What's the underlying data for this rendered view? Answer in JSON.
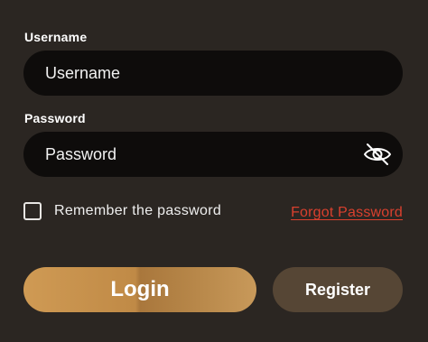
{
  "form": {
    "username": {
      "label": "Username",
      "placeholder": "Username",
      "value": ""
    },
    "password": {
      "label": "Password",
      "placeholder": "Password",
      "value": "",
      "toggle_icon": "eye-slash-icon"
    },
    "remember": {
      "label": "Remember the password",
      "checked": false
    },
    "forgot_label": "Forgot Password",
    "login_label": "Login",
    "register_label": "Register"
  },
  "colors": {
    "background": "#2b2622",
    "input_background": "#0e0c0b",
    "login_gradient_start": "#cf9a54",
    "login_gradient_end": "#c8995a",
    "register_background": "#564635",
    "forgot_link": "#d9402e"
  }
}
